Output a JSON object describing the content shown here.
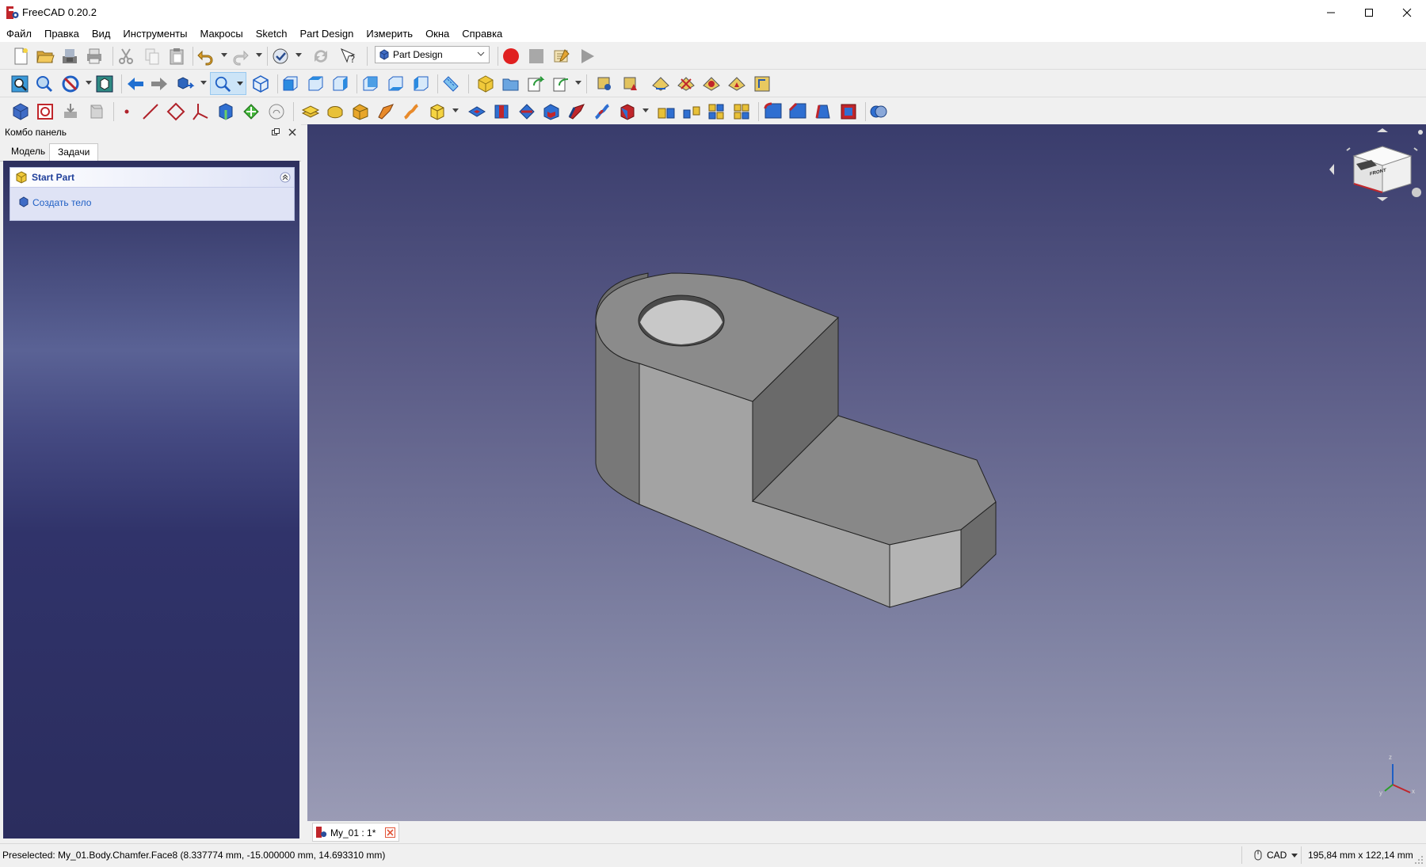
{
  "window": {
    "title": "FreeCAD 0.20.2",
    "controls": [
      "minimize",
      "maximize",
      "close"
    ]
  },
  "menu": [
    "Файл",
    "Правка",
    "Вид",
    "Инструменты",
    "Макросы",
    "Sketch",
    "Part Design",
    "Измерить",
    "Окна",
    "Справка"
  ],
  "toolbar": {
    "workbench_selected": "Part Design"
  },
  "combo_panel": {
    "title": "Комбо панель",
    "tabs": [
      "Модель",
      "Задачи"
    ],
    "active_tab": "Задачи",
    "taskbox": {
      "title": "Start Part",
      "action": "Создать тело"
    }
  },
  "document_tab": {
    "label": "My_01 : 1*"
  },
  "navcube": {
    "face_label": "FRONT"
  },
  "axis": {
    "x": "x",
    "y": "y",
    "z": "z"
  },
  "status": {
    "message": "Preselected: My_01.Body.Chamfer.Face8 (8.337774 mm, -15.000000 mm, 14.693310 mm)",
    "nav_style": "CAD",
    "dimensions": "195,84 mm x 122,14 mm"
  },
  "colors": {
    "accent_blue": "#1f5fc4",
    "record_red": "#e02020",
    "model_gray": "#8e8e8e"
  }
}
